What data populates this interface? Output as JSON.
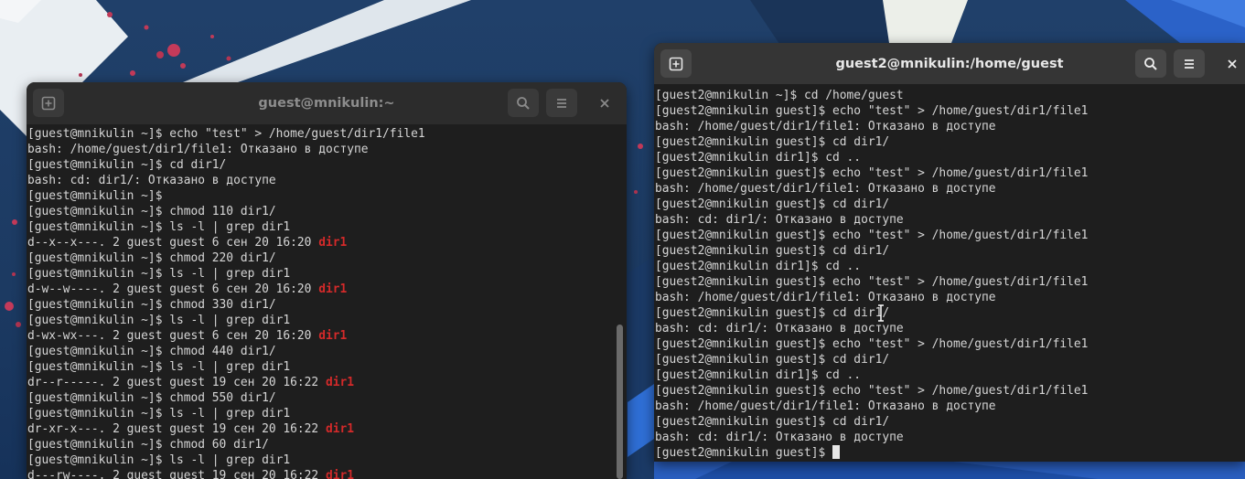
{
  "left_terminal": {
    "title": "guest@mnikulin:~",
    "lines": [
      {
        "text": "[guest@mnikulin ~]$ echo \"test\" > /home/guest/dir1/file1"
      },
      {
        "text": "bash: /home/guest/dir1/file1: Отказано в доступе"
      },
      {
        "text": "[guest@mnikulin ~]$ cd dir1/"
      },
      {
        "text": "bash: cd: dir1/: Отказано в доступе"
      },
      {
        "text": "[guest@mnikulin ~]$"
      },
      {
        "text": "[guest@mnikulin ~]$ chmod 110 dir1/"
      },
      {
        "text": "[guest@mnikulin ~]$ ls -l | grep dir1"
      },
      {
        "text": "d--x--x---. 2 guest guest 6 сен 20 16:20 ",
        "dir": "dir1"
      },
      {
        "text": "[guest@mnikulin ~]$ chmod 220 dir1/"
      },
      {
        "text": "[guest@mnikulin ~]$ ls -l | grep dir1"
      },
      {
        "text": "d-w--w----. 2 guest guest 6 сен 20 16:20 ",
        "dir": "dir1"
      },
      {
        "text": "[guest@mnikulin ~]$ chmod 330 dir1/"
      },
      {
        "text": "[guest@mnikulin ~]$ ls -l | grep dir1"
      },
      {
        "text": "d-wx-wx---. 2 guest guest 6 сен 20 16:20 ",
        "dir": "dir1"
      },
      {
        "text": "[guest@mnikulin ~]$ chmod 440 dir1/"
      },
      {
        "text": "[guest@mnikulin ~]$ ls -l | grep dir1"
      },
      {
        "text": "dr--r-----. 2 guest guest 19 сен 20 16:22 ",
        "dir": "dir1"
      },
      {
        "text": "[guest@mnikulin ~]$ chmod 550 dir1/"
      },
      {
        "text": "[guest@mnikulin ~]$ ls -l | grep dir1"
      },
      {
        "text": "dr-xr-x---. 2 guest guest 19 сен 20 16:22 ",
        "dir": "dir1"
      },
      {
        "text": "[guest@mnikulin ~]$ chmod 60 dir1/"
      },
      {
        "text": "[guest@mnikulin ~]$ ls -l | grep dir1"
      },
      {
        "text": "d---rw----. 2 guest guest 19 сен 20 16:22 ",
        "dir": "dir1"
      }
    ]
  },
  "right_terminal": {
    "title": "guest2@mnikulin:/home/guest",
    "lines": [
      "[guest2@mnikulin ~]$ cd /home/guest",
      "[guest2@mnikulin guest]$ echo \"test\" > /home/guest/dir1/file1",
      "bash: /home/guest/dir1/file1: Отказано в доступе",
      "[guest2@mnikulin guest]$ cd dir1/",
      "[guest2@mnikulin dir1]$ cd ..",
      "[guest2@mnikulin guest]$ echo \"test\" > /home/guest/dir1/file1",
      "bash: /home/guest/dir1/file1: Отказано в доступе",
      "[guest2@mnikulin guest]$ cd dir1/",
      "bash: cd: dir1/: Отказано в доступе",
      "[guest2@mnikulin guest]$ echo \"test\" > /home/guest/dir1/file1",
      "[guest2@mnikulin guest]$ cd dir1/",
      "[guest2@mnikulin dir1]$ cd ..",
      "[guest2@mnikulin guest]$ echo \"test\" > /home/guest/dir1/file1",
      "bash: /home/guest/dir1/file1: Отказано в доступе",
      "[guest2@mnikulin guest]$ cd dir1/",
      "bash: cd: dir1/: Отказано в доступе",
      "[guest2@mnikulin guest]$ echo \"test\" > /home/guest/dir1/file1",
      "[guest2@mnikulin guest]$ cd dir1/",
      "[guest2@mnikulin dir1]$ cd ..",
      "[guest2@mnikulin guest]$ echo \"test\" > /home/guest/dir1/file1",
      "bash: /home/guest/dir1/file1: Отказано в доступе",
      "[guest2@mnikulin guest]$ cd dir1/",
      "bash: cd: dir1/: Отказано в доступе",
      "[guest2@mnikulin guest]$ "
    ]
  },
  "colors": {
    "terminal_bg": "#1e1e1e",
    "terminal_text": "#d6d6d6",
    "directory_highlight": "#d42a2a",
    "wallpaper": "#1d3b63"
  },
  "icons": {
    "new_tab": "new-tab-icon",
    "search": "search-icon",
    "menu": "hamburger-menu-icon",
    "close": "close-icon"
  }
}
